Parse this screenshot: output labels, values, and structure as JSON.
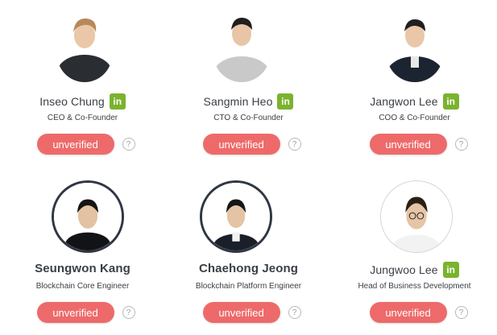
{
  "team": [
    {
      "name": "Inseo Chung",
      "role": "CEO & Co-Founder",
      "linkedin": "in",
      "status": "unverified",
      "help": "?"
    },
    {
      "name": "Sangmin Heo",
      "role": "CTO & Co-Founder",
      "linkedin": "in",
      "status": "unverified",
      "help": "?"
    },
    {
      "name": "Jangwon Lee",
      "role": "COO & Co-Founder",
      "linkedin": "in",
      "status": "unverified",
      "help": "?"
    },
    {
      "name": "Seungwon Kang",
      "role": "Blockchain Core Engineer",
      "status": "unverified",
      "help": "?"
    },
    {
      "name": "Chaehong Jeong",
      "role": "Blockchain Platform Engineer",
      "status": "unverified",
      "help": "?"
    },
    {
      "name": "Jungwoo Lee",
      "role": "Head of Business Development",
      "linkedin": "in",
      "status": "unverified",
      "help": "?"
    }
  ],
  "colors": {
    "unverified": "#ee6a6a",
    "linkedin": "#7ab32e",
    "text": "#3a3f45"
  },
  "icons": {
    "linkedin": "linkedin-icon",
    "help": "question-circle-icon"
  }
}
